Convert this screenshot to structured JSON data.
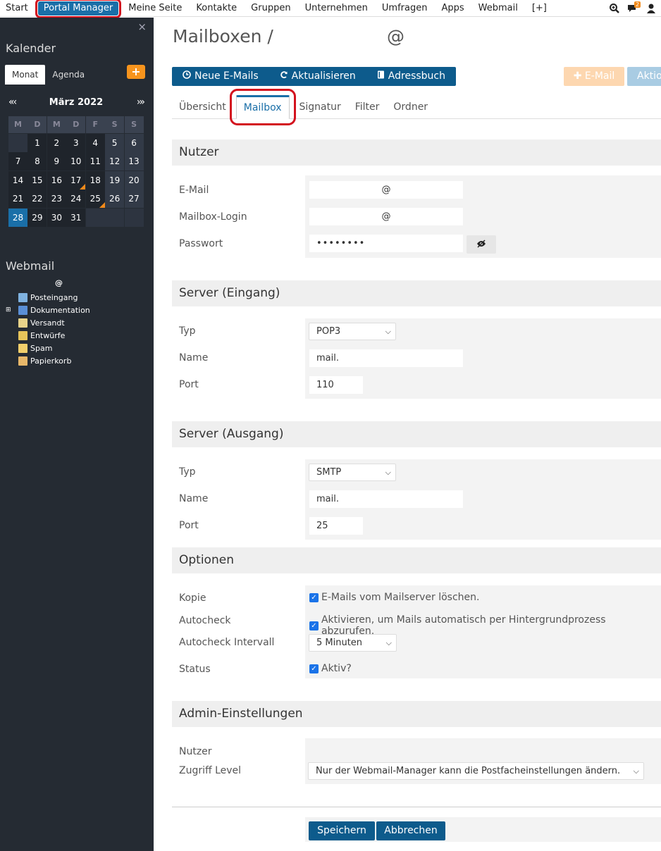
{
  "topnav": {
    "items": [
      "Start",
      "Portal Manager",
      "Meine Seite",
      "Kontakte",
      "Gruppen",
      "Unternehmen",
      "Umfragen",
      "Apps",
      "Webmail",
      "[+]"
    ],
    "chat_badge": "2"
  },
  "sidebar": {
    "close": "×",
    "calendar_title": "Kalender",
    "tabs": [
      "Monat",
      "Agenda"
    ],
    "add": "+",
    "prev": "«‹",
    "next": "›»",
    "month": "März 2022",
    "weekdays": [
      "M",
      "D",
      "M",
      "D",
      "F",
      "S",
      "S"
    ],
    "weeks": [
      [
        "",
        "1",
        "2",
        "3",
        "4",
        "5",
        "6"
      ],
      [
        "7",
        "8",
        "9",
        "10",
        "11",
        "12",
        "13"
      ],
      [
        "14",
        "15",
        "16",
        "17",
        "18",
        "19",
        "20"
      ],
      [
        "21",
        "22",
        "23",
        "24",
        "25",
        "26",
        "27"
      ],
      [
        "28",
        "29",
        "30",
        "31",
        "",
        "",
        ""
      ]
    ],
    "marked_days": [
      "17",
      "25"
    ],
    "today": "28",
    "webmail_title": "Webmail",
    "account": "@",
    "folders": [
      {
        "name": "Posteingang",
        "expand": "",
        "color": "#7fb2e0"
      },
      {
        "name": "Dokumentation",
        "expand": "⊞",
        "color": "#5a8fd6"
      },
      {
        "name": "Versandt",
        "expand": "",
        "color": "#e8d38a"
      },
      {
        "name": "Entwürfe",
        "expand": "",
        "color": "#e6c45a"
      },
      {
        "name": "Spam",
        "expand": "",
        "color": "#f2cf6b"
      },
      {
        "name": "Papierkorb",
        "expand": "",
        "color": "#e8b86a"
      }
    ]
  },
  "main": {
    "title": "Mailboxen /",
    "title_suffix": "@",
    "toolbar": {
      "new_mails": "Neue E-Mails",
      "refresh": "Aktualisieren",
      "address_book": "Adressbuch",
      "email": "E-Mail",
      "actions": "Aktion"
    },
    "tabs": [
      "Übersicht",
      "Mailbox",
      "Signatur",
      "Filter",
      "Ordner"
    ],
    "user_section": {
      "title": "Nutzer",
      "email_label": "E-Mail",
      "email_value": "@",
      "login_label": "Mailbox-Login",
      "login_value": "@",
      "password_label": "Passwort",
      "password_value": "••••••••"
    },
    "incoming": {
      "title": "Server (Eingang)",
      "type_label": "Typ",
      "type_value": "POP3",
      "name_label": "Name",
      "name_value": "mail.",
      "port_label": "Port",
      "port_value": "110"
    },
    "outgoing": {
      "title": "Server (Ausgang)",
      "type_label": "Typ",
      "type_value": "SMTP",
      "name_label": "Name",
      "name_value": "mail.",
      "port_label": "Port",
      "port_value": "25"
    },
    "options": {
      "title": "Optionen",
      "copy_label": "Kopie",
      "copy_text": "E-Mails vom Mailserver löschen.",
      "autocheck_label": "Autocheck",
      "autocheck_text": "Aktivieren, um Mails automatisch per Hintergrundprozess abzurufen.",
      "interval_label": "Autocheck Intervall",
      "interval_value": "5 Minuten",
      "status_label": "Status",
      "status_text": "Aktiv?"
    },
    "admin": {
      "title": "Admin-Einstellungen",
      "user_label": "Nutzer",
      "access_label": "Zugriff Level",
      "access_value": "Nur der Webmail-Manager kann die Postfacheinstellungen ändern."
    },
    "save": "Speichern",
    "cancel": "Abbrechen"
  },
  "colors": {
    "primary": "#0d5b8c",
    "accent": "#f7941d",
    "highlight": "#d3121e",
    "sidebar_bg": "#252b33"
  }
}
